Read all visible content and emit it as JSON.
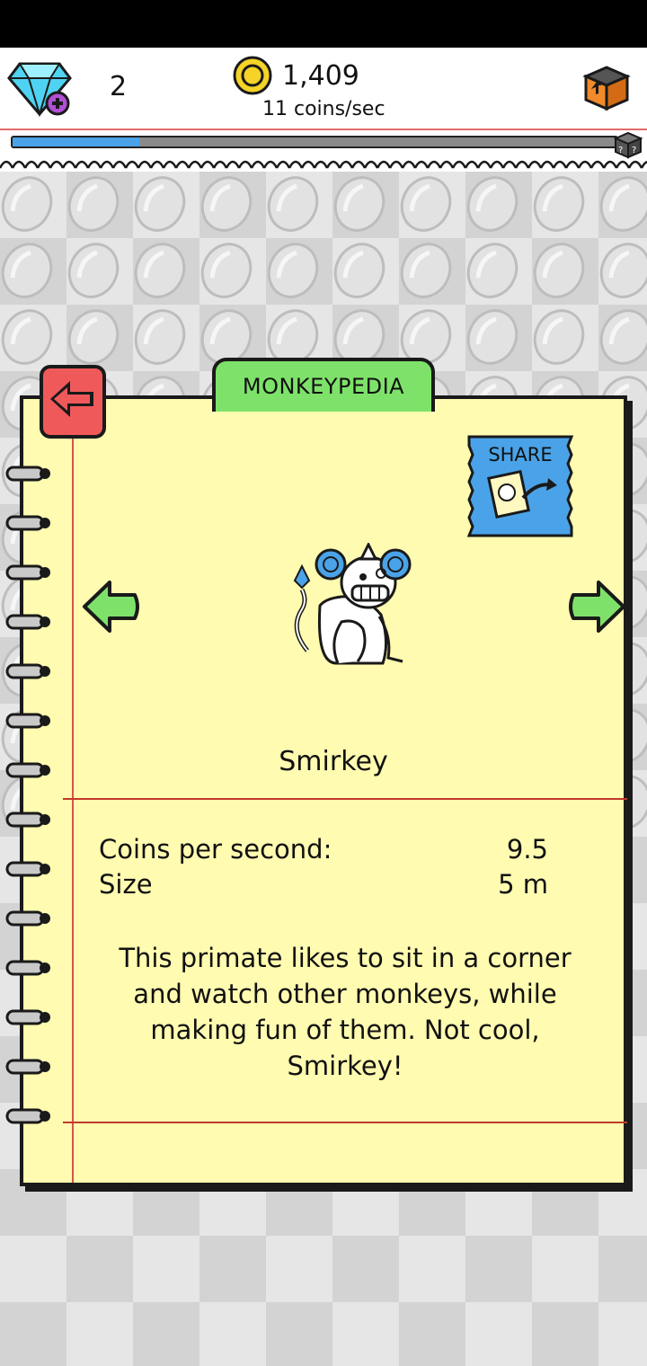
{
  "hud": {
    "gems": "2",
    "coins": "1,409",
    "coin_rate": "11 coins/sec",
    "icons": {
      "gem": "gem-plus-icon",
      "coin": "coin-icon",
      "crate": "upgrade-crate-icon",
      "mystery": "mystery-box-icon"
    }
  },
  "progress": {
    "fraction": 0.21,
    "fill_color": "#4aa3e8"
  },
  "monkeypedia": {
    "tab_title": "MONKEYPEDIA",
    "share_label": "SHARE",
    "monkey_name": "Smirkey",
    "stats": [
      {
        "label": "Coins per second:",
        "value": "9.5"
      },
      {
        "label": "Size",
        "value": "5 m"
      }
    ],
    "description": "This primate likes to sit in a corner and watch other monkeys, while making fun of them. Not cool, Smirkey!"
  },
  "colors": {
    "page_yellow": "#fffbb0",
    "tab_green": "#7ee26a",
    "back_red": "#f0595a",
    "share_blue": "#4aa3e8",
    "arrow_green": "#7ee26a"
  }
}
